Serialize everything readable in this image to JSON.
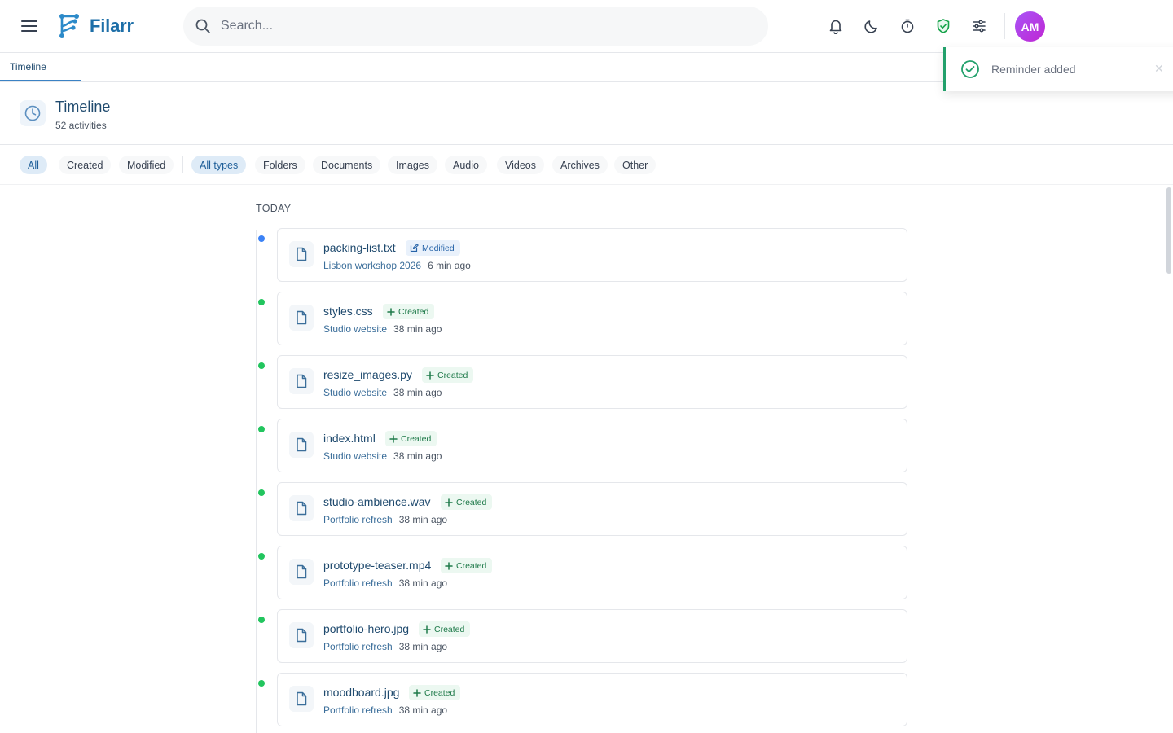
{
  "app": {
    "name": "Filarr",
    "avatar_initials": "AM",
    "brand_color": "#1e6fa8",
    "avatar_color": "#b045e6"
  },
  "search": {
    "placeholder": "Search...",
    "value": ""
  },
  "header_icons": [
    "bell-icon",
    "moon-icon",
    "timer-icon",
    "shield-check-icon",
    "sliders-icon"
  ],
  "tabs": [
    {
      "label": "Timeline",
      "active": true
    }
  ],
  "toast": {
    "message": "Reminder added",
    "icon": "check-circle-icon",
    "color": "#22a06b"
  },
  "page": {
    "title": "Timeline",
    "subtitle": "52 activities"
  },
  "filters": {
    "activity": [
      {
        "label": "All",
        "active": true
      },
      {
        "label": "Created",
        "active": false
      },
      {
        "label": "Modified",
        "active": false
      }
    ],
    "types": [
      {
        "label": "All types",
        "active": true
      },
      {
        "label": "Folders",
        "active": false
      },
      {
        "label": "Documents",
        "active": false
      },
      {
        "label": "Images",
        "active": false
      },
      {
        "label": "Audio",
        "active": false
      },
      {
        "label": "Videos",
        "active": false
      },
      {
        "label": "Archives",
        "active": false
      },
      {
        "label": "Other",
        "active": false
      }
    ]
  },
  "timeline": {
    "section": "TODAY",
    "items": [
      {
        "name": "packing-list.txt",
        "action": "Modified",
        "folder": "Lisbon workshop 2026",
        "time": "6 min ago"
      },
      {
        "name": "styles.css",
        "action": "Created",
        "folder": "Studio website",
        "time": "38 min ago"
      },
      {
        "name": "resize_images.py",
        "action": "Created",
        "folder": "Studio website",
        "time": "38 min ago"
      },
      {
        "name": "index.html",
        "action": "Created",
        "folder": "Studio website",
        "time": "38 min ago"
      },
      {
        "name": "studio-ambience.wav",
        "action": "Created",
        "folder": "Portfolio refresh",
        "time": "38 min ago"
      },
      {
        "name": "prototype-teaser.mp4",
        "action": "Created",
        "folder": "Portfolio refresh",
        "time": "38 min ago"
      },
      {
        "name": "portfolio-hero.jpg",
        "action": "Created",
        "folder": "Portfolio refresh",
        "time": "38 min ago"
      },
      {
        "name": "moodboard.jpg",
        "action": "Created",
        "folder": "Portfolio refresh",
        "time": "38 min ago"
      }
    ]
  },
  "colors": {
    "created": "#22c55e",
    "modified": "#3b82f6"
  }
}
